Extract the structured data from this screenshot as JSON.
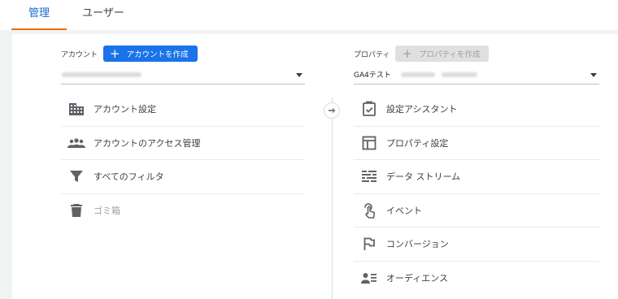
{
  "tabs": {
    "admin": "管理",
    "user": "ユーザー"
  },
  "account": {
    "header_label": "アカウント",
    "create_button": "アカウントを作成",
    "selector_value": "",
    "items": [
      {
        "label": "アカウント設定",
        "icon": "building-icon",
        "disabled": false
      },
      {
        "label": "アカウントのアクセス管理",
        "icon": "people-icon",
        "disabled": false
      },
      {
        "label": "すべてのフィルタ",
        "icon": "filter-icon",
        "disabled": false
      },
      {
        "label": "ゴミ箱",
        "icon": "trash-icon",
        "disabled": true
      }
    ]
  },
  "property": {
    "header_label": "プロパティ",
    "create_button": "プロパティを作成",
    "selector_value": "GA4テスト",
    "items": [
      {
        "label": "設定アシスタント",
        "icon": "checklist-icon",
        "disabled": false
      },
      {
        "label": "プロパティ設定",
        "icon": "layout-icon",
        "disabled": false
      },
      {
        "label": "データ ストリーム",
        "icon": "streams-icon",
        "disabled": false
      },
      {
        "label": "イベント",
        "icon": "touch-icon",
        "disabled": false
      },
      {
        "label": "コンバージョン",
        "icon": "flag-icon",
        "disabled": false
      },
      {
        "label": "オーディエンス",
        "icon": "audience-icon",
        "disabled": false
      }
    ]
  },
  "colors": {
    "accent_blue": "#1a73e8",
    "tab_active_text": "#1967d2",
    "tab_underline": "#e8710a",
    "icon_gray": "#5f6368",
    "disabled_gray": "#9aa0a6"
  }
}
